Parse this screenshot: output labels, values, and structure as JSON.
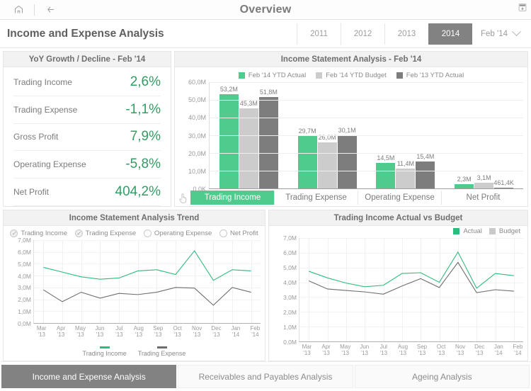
{
  "topbar": {
    "title": "Overview",
    "home_icon": "home-icon",
    "back_icon": "back-arrow-icon",
    "corner_icon": "export-icon"
  },
  "header": {
    "page_title": "Income and Expense Analysis",
    "year_tabs": [
      {
        "label": "2011",
        "active": false
      },
      {
        "label": "2012",
        "active": false
      },
      {
        "label": "2013",
        "active": false
      },
      {
        "label": "2014",
        "active": true
      }
    ],
    "month_selector": {
      "label": "Feb '14",
      "icon": "chevron-down-icon"
    }
  },
  "kpi_card": {
    "title": "YoY Growth / Decline - Feb '14",
    "rows": [
      {
        "label": "Trading Income",
        "value": "2,6%"
      },
      {
        "label": "Trading Expense",
        "value": "-1,1%"
      },
      {
        "label": "Gross Profit",
        "value": "7,9%"
      },
      {
        "label": "Operating Expense",
        "value": "-5,8%"
      },
      {
        "label": "Net Profit",
        "value": "404,2%"
      }
    ]
  },
  "bar_card": {
    "title": "Income Statement Analysis - Feb '14",
    "legend": [
      {
        "label": "Feb '14 YTD Actual",
        "color": "#4ecb8d"
      },
      {
        "label": "Feb '14 YTD Budget",
        "color": "#cccccc"
      },
      {
        "label": "Feb '13 YTD Actual",
        "color": "#7d7d7d"
      }
    ],
    "category_tabs": [
      {
        "label": "Trading Income",
        "active": true
      },
      {
        "label": "Trading Expense",
        "active": false
      },
      {
        "label": "Operating Expense",
        "active": false
      },
      {
        "label": "Net Profit",
        "active": false
      }
    ],
    "pointer_icon": "hand-pointer-icon"
  },
  "trend_card": {
    "title": "Income Statement Analysis Trend",
    "filters": [
      {
        "label": "Trading Income",
        "checked": true
      },
      {
        "label": "Trading Expense",
        "checked": true
      },
      {
        "label": "Operating Expense",
        "checked": false
      },
      {
        "label": "Net Profit",
        "checked": false
      }
    ],
    "legend": [
      {
        "label": "Trading Income",
        "color": "#2fbb7d"
      },
      {
        "label": "Trading Expense",
        "color": "#6e6e6e"
      }
    ]
  },
  "avb_card": {
    "title": "Trading Income Actual vs Budget",
    "legend": [
      {
        "label": "Actual",
        "color": "#2fbb7d"
      },
      {
        "label": "Budget",
        "color": "#c9c9c9"
      }
    ]
  },
  "bottom_tabs": [
    {
      "label": "Income and Expense Analysis",
      "active": true
    },
    {
      "label": "Receivables and Payables Analysis",
      "active": false
    },
    {
      "label": "Ageing Analysis",
      "active": false
    }
  ],
  "chart_data": [
    {
      "id": "income_statement_bars",
      "type": "bar",
      "title": "Income Statement Analysis - Feb '14",
      "categories": [
        "Trading Income",
        "Trading Expense",
        "Operating Expense",
        "Net Profit"
      ],
      "series": [
        {
          "name": "Feb '14 YTD Actual",
          "color": "#4ecb8d",
          "values": [
            53200000,
            29700000,
            14500000,
            2300000
          ],
          "labels": [
            "53,2M",
            "29,7M",
            "14,5M",
            "2,3M"
          ]
        },
        {
          "name": "Feb '14 YTD Budget",
          "color": "#cccccc",
          "values": [
            45300000,
            26000000,
            11400000,
            3100000
          ],
          "labels": [
            "45,3M",
            "26,0M",
            "11,4M",
            "3,1M"
          ]
        },
        {
          "name": "Feb '13 YTD Actual",
          "color": "#7d7d7d",
          "values": [
            51800000,
            30100000,
            15400000,
            461400
          ],
          "labels": [
            "51,8M",
            "30,1M",
            "15,4M",
            "461,4K"
          ]
        }
      ],
      "ylabel": "",
      "xlabel": "",
      "ylim": [
        0,
        60000000
      ],
      "yticks": [
        "0,0K",
        "10,0M",
        "20,0M",
        "30,0M",
        "40,0M",
        "50,0M",
        "60,0M"
      ],
      "grid": true,
      "legend_position": "top"
    },
    {
      "id": "income_statement_trend",
      "type": "line",
      "title": "Income Statement Analysis Trend",
      "x": [
        "Mar '13",
        "Apr '13",
        "May '13",
        "Jun '13",
        "Jul '13",
        "Aug '13",
        "Sep '13",
        "Oct '13",
        "Nov '13",
        "Dec '13",
        "Jan '14",
        "Feb '14"
      ],
      "series": [
        {
          "name": "Trading Income",
          "color": "#2fbb7d",
          "values": [
            4.7,
            4.3,
            3.9,
            3.7,
            3.8,
            4.4,
            4.5,
            4.1,
            6.1,
            3.6,
            4.5,
            4.4
          ]
        },
        {
          "name": "Trading Expense",
          "color": "#6e6e6e",
          "values": [
            2.8,
            1.8,
            2.6,
            2.1,
            2.5,
            2.4,
            2.6,
            3.0,
            2.95,
            1.5,
            3.0,
            2.6
          ]
        }
      ],
      "ylim": [
        0,
        7
      ],
      "yticks": [
        "0,0M",
        "1,0M",
        "2,0M",
        "3,0M",
        "4,0M",
        "5,0M",
        "6,0M",
        "7,0M"
      ],
      "grid": true,
      "legend_position": "bottom"
    },
    {
      "id": "trading_income_actual_vs_budget",
      "type": "line",
      "title": "Trading Income Actual vs Budget",
      "x": [
        "Mar '13",
        "Apr '13",
        "May '13",
        "Jun '13",
        "Jul '13",
        "Aug '13",
        "Sep '13",
        "Oct '13",
        "Nov '13",
        "Dec '13",
        "Jan '14",
        "Feb '14"
      ],
      "series": [
        {
          "name": "Actual",
          "color": "#2fbb7d",
          "values": [
            4.75,
            4.3,
            3.95,
            3.7,
            3.8,
            4.6,
            4.65,
            4.0,
            6.05,
            3.6,
            4.6,
            4.45
          ]
        },
        {
          "name": "Budget",
          "color": "#6e6e6e",
          "values": [
            4.1,
            3.55,
            3.45,
            3.35,
            3.2,
            3.75,
            4.25,
            3.65,
            5.35,
            3.3,
            3.5,
            3.4
          ]
        }
      ],
      "ylim": [
        0,
        7
      ],
      "yticks": [
        "0,0M",
        "1,0M",
        "2,0M",
        "3,0M",
        "4,0M",
        "5,0M",
        "6,0M",
        "7,0M"
      ],
      "grid": true,
      "legend_position": "top-right"
    }
  ]
}
